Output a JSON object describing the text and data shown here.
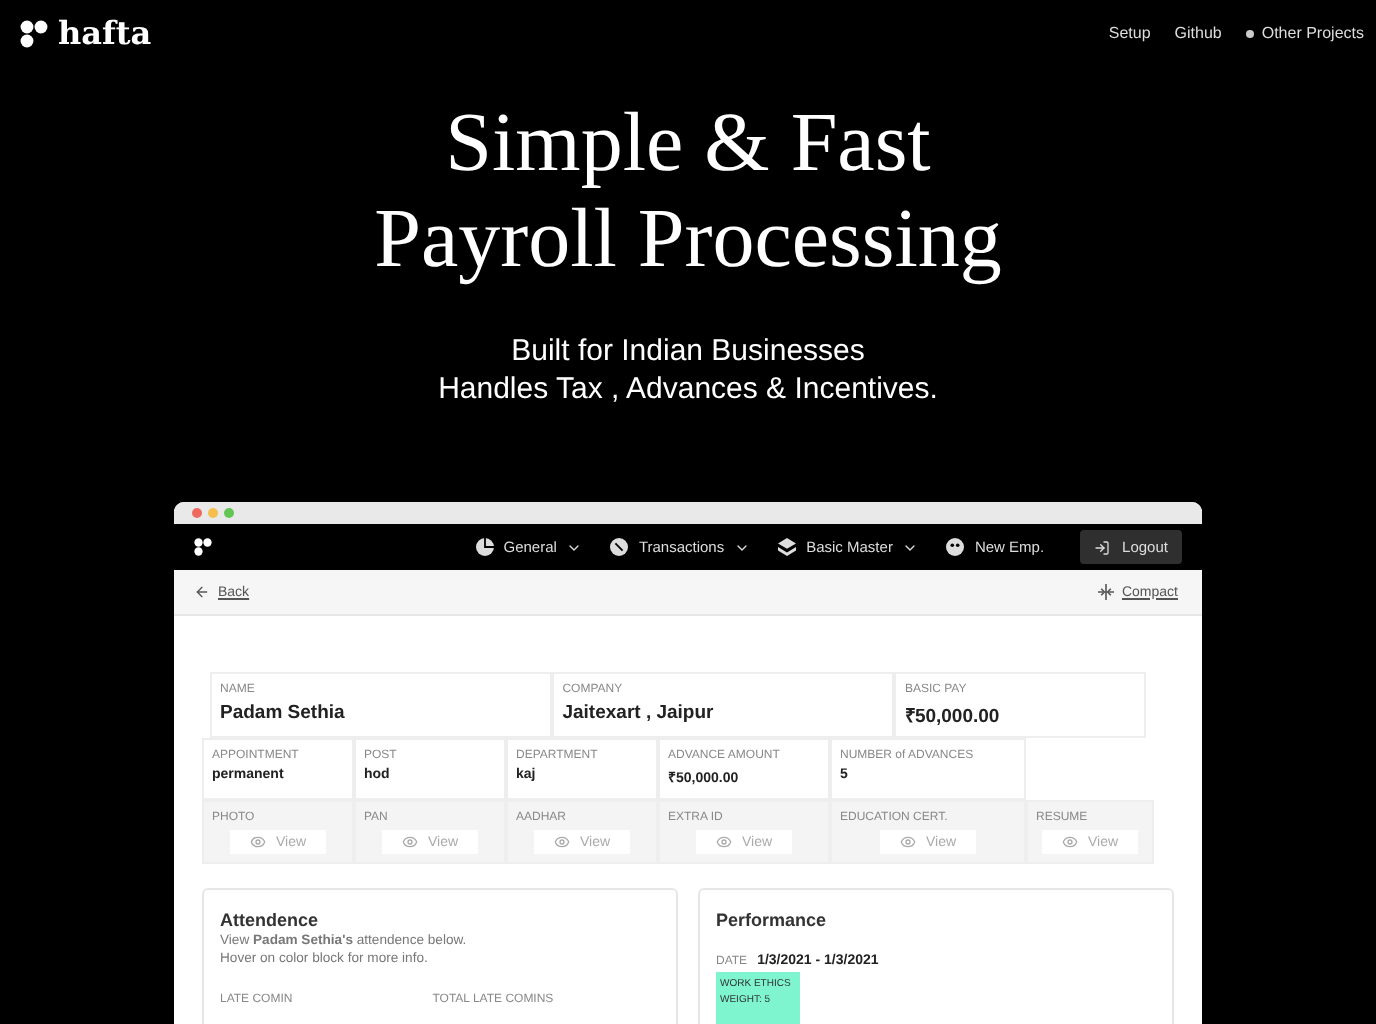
{
  "brand": "hafta",
  "nav": [
    "Setup",
    "Github",
    "Other Projects"
  ],
  "hero": {
    "title_lines": [
      "Simple & Fast",
      "Payroll Processing"
    ],
    "subtitle_lines": [
      "Built for Indian Businesses",
      "Handles Tax , Advances & Incentives."
    ]
  },
  "app": {
    "menu": [
      {
        "label": "General",
        "kind": "pie",
        "dropdown": true
      },
      {
        "label": "Transactions",
        "kind": "coin",
        "dropdown": true
      },
      {
        "label": "Basic Master",
        "kind": "layers",
        "dropdown": true
      },
      {
        "label": "New Emp.",
        "kind": "face",
        "dropdown": false
      }
    ],
    "logout": "Logout",
    "back": "Back",
    "compact": "Compact",
    "top_fields": [
      {
        "label": "NAME",
        "value": "Padam Sethia"
      },
      {
        "label": "COMPANY",
        "value": "Jaitexart , Jaipur"
      },
      {
        "label": "BASIC PAY",
        "value": "₹50,000.00"
      }
    ],
    "detail_fields": [
      {
        "label": "APPOINTMENT",
        "value": "permanent"
      },
      {
        "label": "POST",
        "value": "hod"
      },
      {
        "label": "DEPARTMENT",
        "value": "kaj"
      },
      {
        "label": "ADVANCE AMOUNT",
        "value": "₹50,000.00"
      },
      {
        "label": "NUMBER of ADVANCES",
        "value": "5"
      }
    ],
    "documents": [
      {
        "label": "PHOTO",
        "action": "View"
      },
      {
        "label": "PAN",
        "action": "View"
      },
      {
        "label": "AADHAR",
        "action": "View"
      },
      {
        "label": "EXTRA ID",
        "action": "View"
      },
      {
        "label": "EDUCATION CERT.",
        "action": "View"
      },
      {
        "label": "RESUME",
        "action": "View"
      }
    ],
    "attendance": {
      "title": "Attendence",
      "description": "View **Padam Sethia's** attendence below.",
      "hint": "Hover on color block for more info.",
      "stats": [
        "LATE COMIN",
        "TOTAL LATE COMINS"
      ]
    },
    "performance": {
      "title": "Performance",
      "date_label": "DATE",
      "date_range": "1/3/2021 - 1/3/2021",
      "blocks": [
        {
          "title": "WORK ETHICS",
          "weight": "WEIGHT: 5",
          "color": "#7ef5cf"
        }
      ]
    }
  }
}
